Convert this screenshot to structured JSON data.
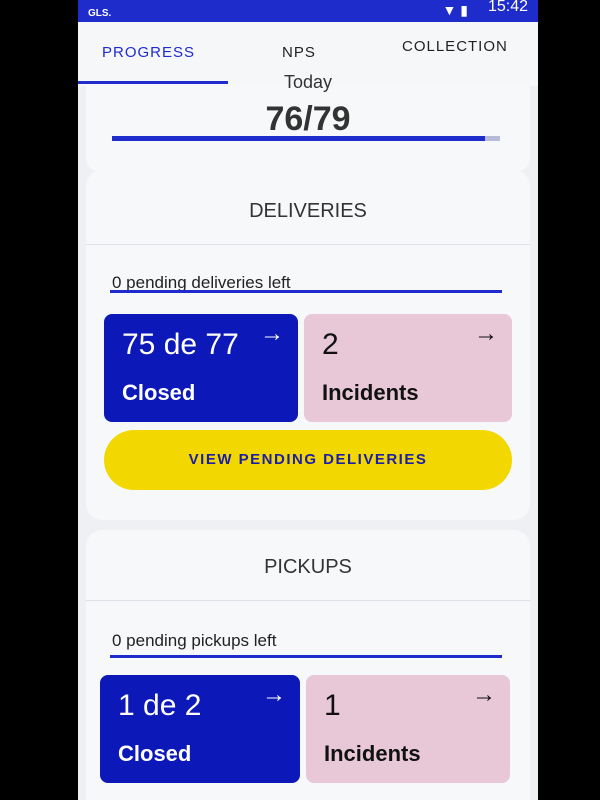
{
  "status": {
    "logo": "GLS.",
    "time": "15:42",
    "icons": [
      "wifi-icon",
      "battery-icon"
    ]
  },
  "tabs": [
    {
      "label": "PROGRESS",
      "active": true
    },
    {
      "label": "NPS"
    },
    {
      "label": "COLLECTION"
    }
  ],
  "today": {
    "label": "Today",
    "value": "76/79",
    "progress_fraction": 0.962
  },
  "deliveries": {
    "title": "DELIVERIES",
    "pending": "0 pending deliveries left",
    "closed": {
      "value": "75 de 77",
      "label": "Closed"
    },
    "incidents": {
      "value": "2",
      "label": "Incidents"
    },
    "button": "VIEW PENDING DELIVERIES"
  },
  "pickups": {
    "title": "PICKUPS",
    "pending": "0 pending pickups left",
    "closed": {
      "value": "1 de 2",
      "label": "Closed"
    },
    "incidents": {
      "value": "1",
      "label": "Incidents"
    }
  },
  "colors": {
    "accent": "#1f2ccc",
    "closed_bg": "#0d18b8",
    "incidents_bg": "#e8c8d6",
    "button_bg": "#f2d800"
  }
}
